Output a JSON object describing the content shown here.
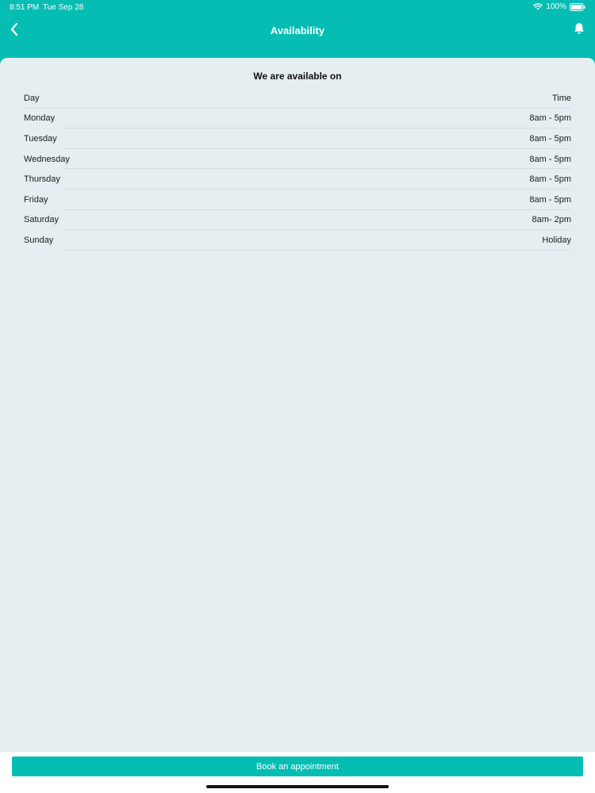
{
  "status_bar": {
    "time": "8:51 PM",
    "date": "Tue Sep 28",
    "battery": "100%"
  },
  "nav": {
    "title": "Availability",
    "back_icon": "chevron-left-icon",
    "bell_icon": "bell-icon"
  },
  "availability": {
    "heading": "We are available on",
    "columns": {
      "day": "Day",
      "time": "Time"
    },
    "rows": [
      {
        "day": "Monday",
        "time": "8am - 5pm"
      },
      {
        "day": "Tuesday",
        "time": "8am - 5pm"
      },
      {
        "day": "Wednesday",
        "time": "8am - 5pm"
      },
      {
        "day": "Thursday",
        "time": "8am - 5pm"
      },
      {
        "day": "Friday",
        "time": "8am - 5pm"
      },
      {
        "day": "Saturday",
        "time": "8am- 2pm"
      },
      {
        "day": "Sunday",
        "time": "Holiday"
      }
    ]
  },
  "footer": {
    "book_label": "Book an appointment"
  },
  "colors": {
    "accent": "#06bdb3",
    "background": "#e5eef0"
  }
}
